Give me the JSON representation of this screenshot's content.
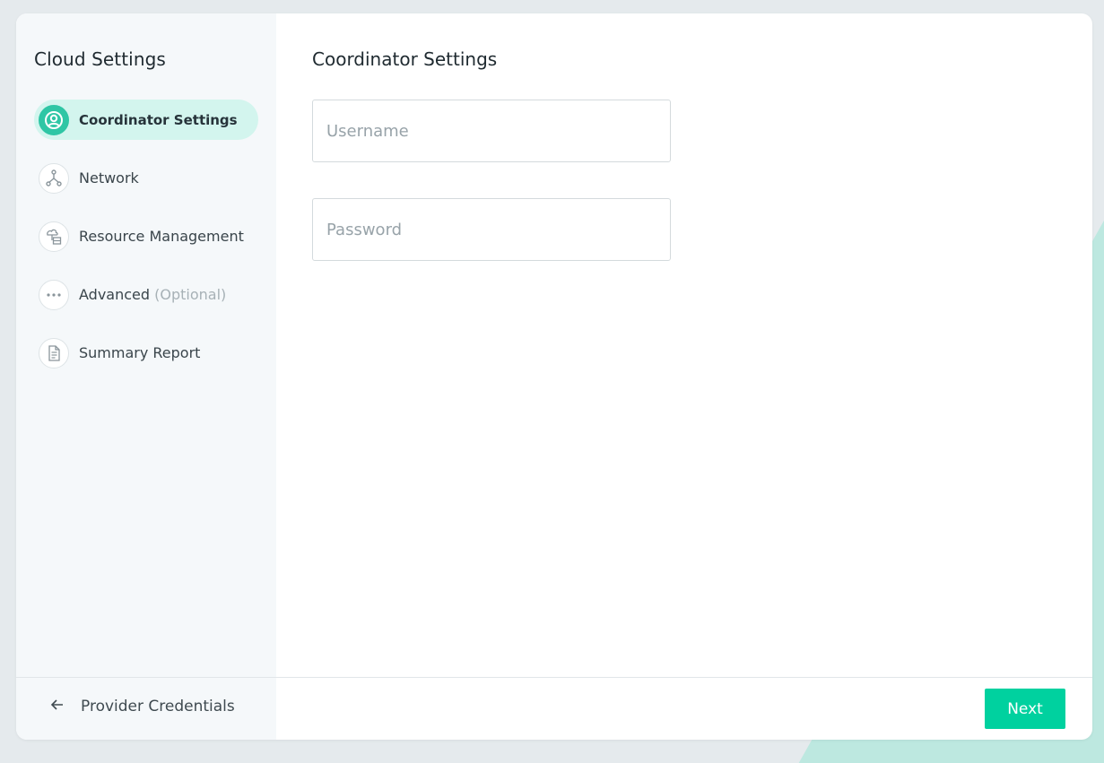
{
  "sidebar": {
    "title": "Cloud Settings",
    "steps": [
      {
        "label": "Coordinator Settings",
        "icon": "user-circle-icon",
        "active": true
      },
      {
        "label": "Network",
        "icon": "network-icon",
        "active": false
      },
      {
        "label": "Resource Management",
        "icon": "resource-icon",
        "active": false
      },
      {
        "label": "Advanced",
        "suffix": "(Optional)",
        "icon": "more-dots-icon",
        "active": false
      },
      {
        "label": "Summary Report",
        "icon": "report-icon",
        "active": false
      }
    ]
  },
  "main": {
    "title": "Coordinator Settings",
    "username": {
      "placeholder": "Username",
      "value": ""
    },
    "password": {
      "placeholder": "Password",
      "value": ""
    }
  },
  "footer": {
    "back_label": "Provider Credentials",
    "next_label": "Next"
  },
  "colors": {
    "accent": "#00d19f",
    "active_step_bg": "#d3f5ee",
    "sidebar_bg": "#f5f8fa"
  }
}
